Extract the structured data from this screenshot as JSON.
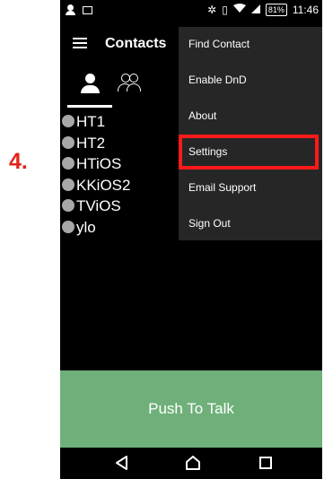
{
  "annotation": {
    "step_label": "4."
  },
  "status_bar": {
    "battery": "81%",
    "time": "11:46",
    "icons": [
      "person-icon",
      "image-icon",
      "bluetooth-icon",
      "vibrate-icon",
      "wifi-icon",
      "signal-icon",
      "battery-icon"
    ]
  },
  "app_bar": {
    "title": "Contacts",
    "menu_icon": "hamburger-icon"
  },
  "tabs": [
    {
      "name": "contacts-tab",
      "icon": "person-icon",
      "selected": true
    },
    {
      "name": "groups-tab",
      "icon": "group-icon",
      "selected": false
    }
  ],
  "contacts": [
    {
      "name": "HT1"
    },
    {
      "name": "HT2"
    },
    {
      "name": "HTiOS"
    },
    {
      "name": "KKiOS2"
    },
    {
      "name": "TViOS"
    },
    {
      "name": "ylo"
    }
  ],
  "menu": {
    "items": [
      {
        "label": "Find Contact"
      },
      {
        "label": "Enable DnD"
      },
      {
        "label": "About"
      },
      {
        "label": "Settings",
        "highlighted": true
      },
      {
        "label": "Email Support"
      },
      {
        "label": "Sign Out"
      }
    ]
  },
  "push_to_talk": {
    "label": "Push To Talk",
    "color": "#6fb07a"
  },
  "colors": {
    "highlight": "#ff1a1a",
    "annotation": "#e2231a",
    "menu_bg": "#262626",
    "presence_dot": "#a8a8a8"
  }
}
